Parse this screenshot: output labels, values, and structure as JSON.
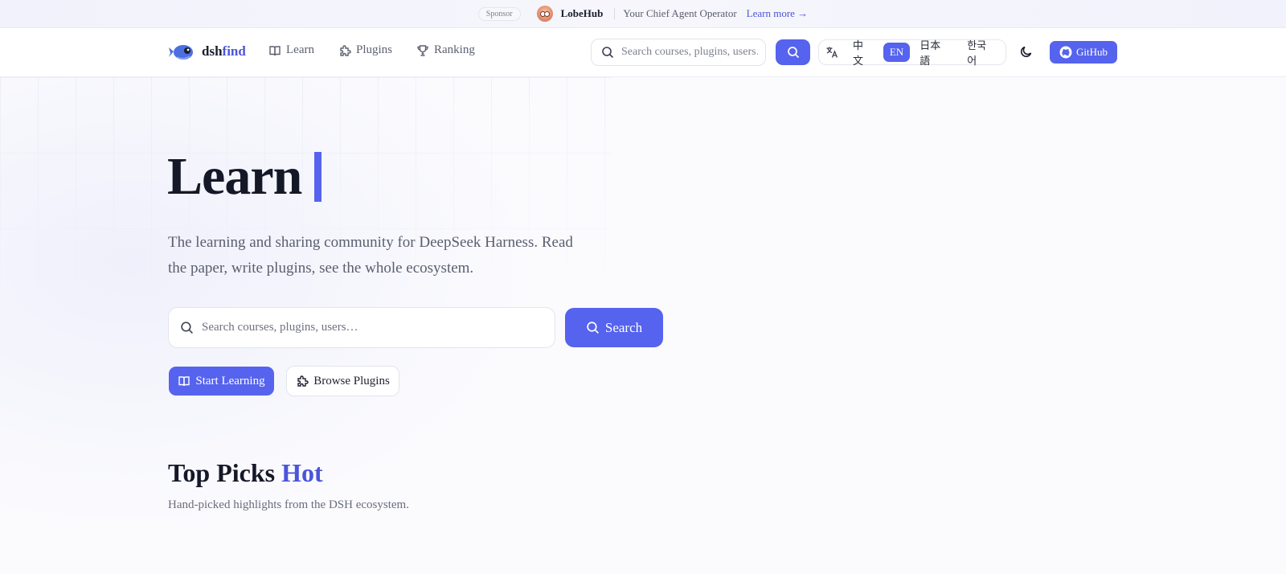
{
  "sponsor": {
    "tag": "Sponsor",
    "name": "LobeHub",
    "tagline": "Your Chief Agent Operator",
    "link": "Learn more →"
  },
  "nav": {
    "logo_main": "dsh",
    "logo_accent": "find",
    "links": [
      {
        "label": "Learn",
        "icon": "book-icon"
      },
      {
        "label": "Plugins",
        "icon": "puzzle-icon"
      },
      {
        "label": "Ranking",
        "icon": "trophy-icon"
      }
    ],
    "search_placeholder": "Search courses, plugins, users…",
    "languages": [
      {
        "label": "中文",
        "active": false
      },
      {
        "label": "EN",
        "active": true
      },
      {
        "label": "日本語",
        "active": false
      },
      {
        "label": "한국어",
        "active": false
      }
    ],
    "github_label": "GitHub"
  },
  "hero": {
    "title": "Learn",
    "description": "The learning and sharing community for DeepSeek Harness. Read the paper, write plugins, see the whole ecosystem.",
    "search_placeholder": "Search courses, plugins, users…",
    "search_button": "Search",
    "start_button": "Start Learning",
    "browse_button": "Browse Plugins"
  },
  "top_picks": {
    "title": "Top Picks",
    "title_accent": "Hot",
    "subtitle": "Hand-picked highlights from the DSH ecosystem."
  },
  "colors": {
    "accent": "#5563ee",
    "text": "#1a1d2b"
  }
}
